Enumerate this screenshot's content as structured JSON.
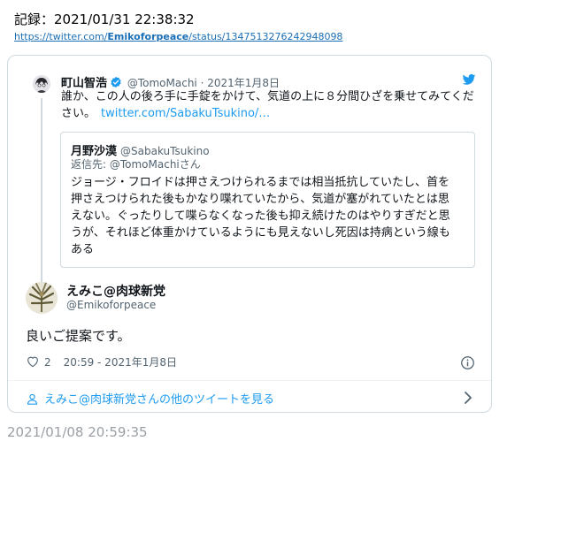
{
  "record": {
    "line": "記録：2021/01/31 22:38:32",
    "url_prefix": "https://twitter.com/",
    "url_user": "Emikoforpeace",
    "url_suffix": "/status/1347513276242948098"
  },
  "quoted_tweet": {
    "name": "町山智浩",
    "handle": "@TomoMachi",
    "separator": "·",
    "date": "2021年1月8日",
    "text": "誰か、この人の後ろ手に手錠をかけて、気道の上に８分間ひざを乗せてみてください。",
    "link": "twitter.com/SabakuTsukino/…",
    "inner": {
      "name": "月野沙漠",
      "handle": "@SabakuTsukino",
      "reply_to": "返信先: @TomoMachiさん",
      "text": "ジョージ・フロイドは押さえつけられるまでは相当抵抗していたし、首を押さえつけられた後もかなり喋れていたから、気道が塞がれていたとは思えない。ぐったりして喋らなくなった後も抑え続けたのはやりすぎだと思うが、それほど体重かけているようにも見えないし死因は持病という線もある"
    }
  },
  "main_tweet": {
    "name": "えみこ@肉球新党",
    "handle": "@Emikoforpeace",
    "text": "良いご提案です。",
    "likes": "2",
    "timestamp": "20:59 - 2021年1月8日"
  },
  "more_link": "えみこ@肉球新党さんの他のツイートを見る",
  "footer_time": "2021/01/08 20:59:35",
  "icons": {
    "verified": "verified-badge-icon",
    "bird": "twitter-bird-icon",
    "heart": "heart-icon",
    "info": "info-icon",
    "person": "person-icon",
    "chevron": "chevron-right-icon"
  },
  "colors": {
    "link_blue": "#1d9bf0",
    "muted": "#536471",
    "border": "#cfd9de",
    "record_url": "#1b6fb7",
    "footer_gray": "#9aa0a6"
  }
}
